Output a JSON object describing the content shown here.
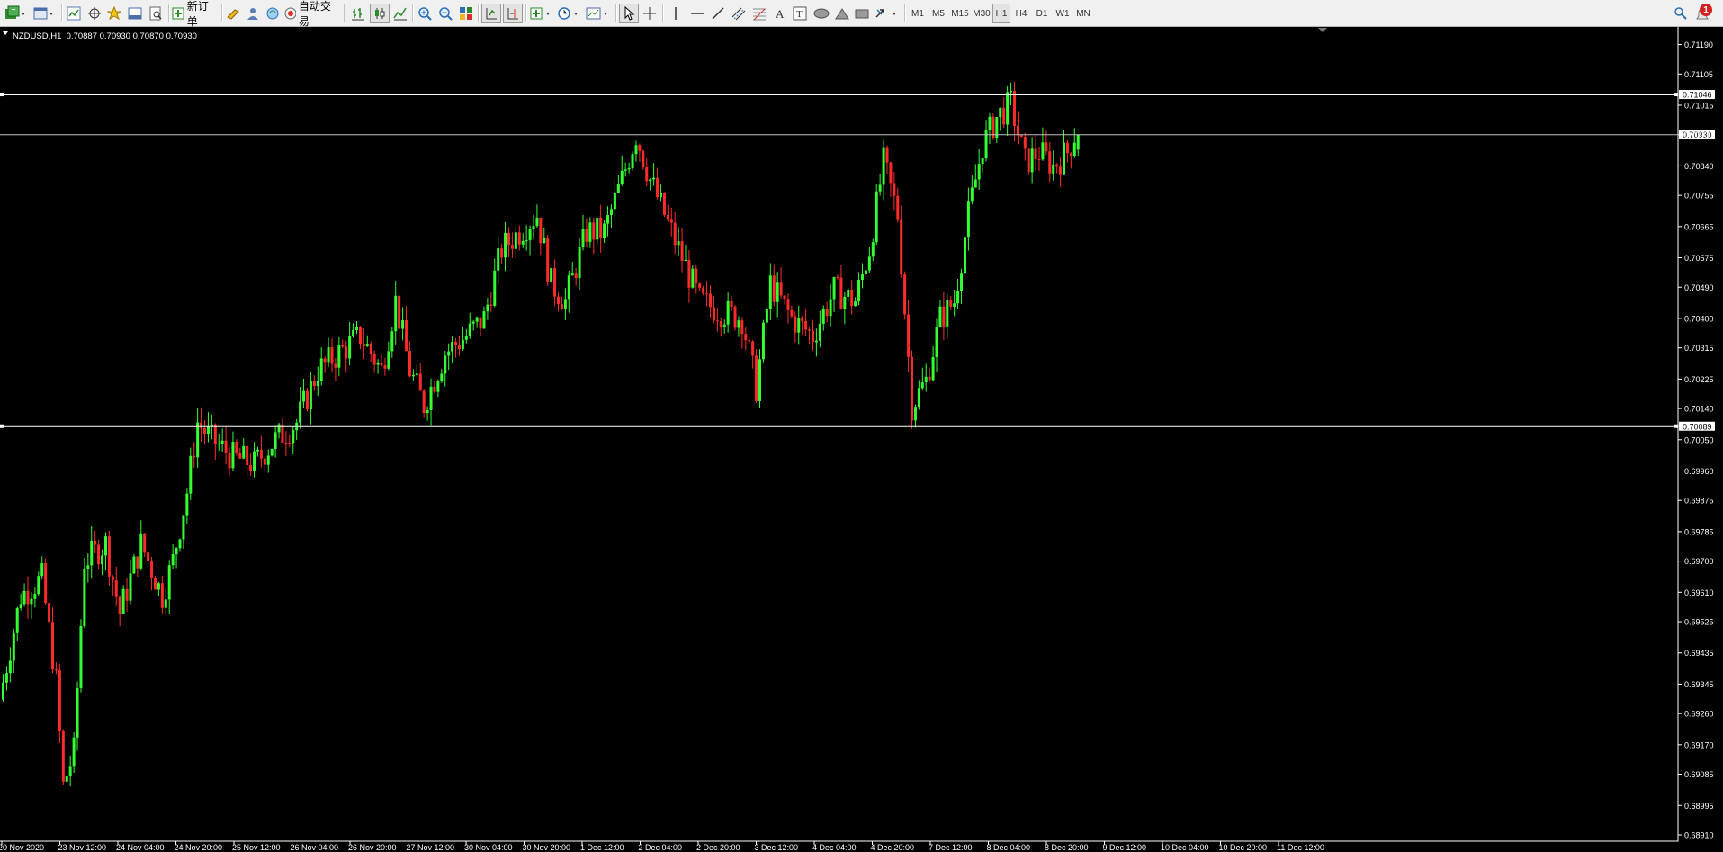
{
  "toolbar": {
    "new_order_label": "新订单",
    "auto_trade_label": "自动交易",
    "timeframes": [
      "M1",
      "M5",
      "M15",
      "M30",
      "H1",
      "H4",
      "D1",
      "W1",
      "MN"
    ],
    "active_timeframe": "H1",
    "notification_count": "1"
  },
  "chart_header": {
    "symbol_info": "NZDUSD,H1  0.70887 0.70930 0.70870 0.70930"
  },
  "colors": {
    "background": "#000000",
    "bull_candle": "#33ff33",
    "bear_candle": "#ff2b2b",
    "axis_text": "#ffffff",
    "hline": "#ffffff",
    "price_line": "#c0c0c0"
  },
  "chart_data": {
    "type": "candlestick",
    "symbol": "NZDUSD",
    "timeframe": "H1",
    "last_bar": {
      "open": 0.70887,
      "high": 0.7093,
      "low": 0.7087,
      "close": 0.7093
    },
    "y_ticks": [
      "0.71190",
      "0.71105",
      "0.71015",
      "0.70930",
      "0.70840",
      "0.70755",
      "0.70665",
      "0.70575",
      "0.70490",
      "0.70400",
      "0.70315",
      "0.70225",
      "0.70140",
      "0.70050",
      "0.69960",
      "0.69875",
      "0.69785",
      "0.69700",
      "0.69610",
      "0.69525",
      "0.69435",
      "0.69345",
      "0.69260",
      "0.69170",
      "0.69085",
      "0.68995",
      "0.68910"
    ],
    "ylim": [
      0.6891,
      0.7122
    ],
    "x_ticks": [
      "20 Nov 2020",
      "23 Nov 12:00",
      "24 Nov 04:00",
      "24 Nov 20:00",
      "25 Nov 12:00",
      "26 Nov 04:00",
      "26 Nov 20:00",
      "27 Nov 12:00",
      "30 Nov 04:00",
      "30 Nov 20:00",
      "1 Dec 12:00",
      "2 Dec 04:00",
      "2 Dec 20:00",
      "3 Dec 12:00",
      "4 Dec 04:00",
      "4 Dec 20:00",
      "7 Dec 12:00",
      "8 Dec 04:00",
      "8 Dec 20:00",
      "9 Dec 12:00",
      "10 Dec 04:00",
      "10 Dec 20:00",
      "11 Dec 12:00"
    ],
    "horizontal_lines": [
      {
        "price": 0.71046,
        "label": "0.71046"
      },
      {
        "price": 0.70089,
        "label": "0.70089"
      }
    ],
    "current_price": {
      "price": 0.7093,
      "label": "0.70930"
    },
    "anchors": [
      [
        0,
        0.693
      ],
      [
        6,
        0.696
      ],
      [
        12,
        0.6965
      ],
      [
        16,
        0.6935
      ],
      [
        18,
        0.6905
      ],
      [
        21,
        0.6915
      ],
      [
        24,
        0.697
      ],
      [
        30,
        0.6975
      ],
      [
        34,
        0.6955
      ],
      [
        40,
        0.6975
      ],
      [
        46,
        0.696
      ],
      [
        49,
        0.697
      ],
      [
        53,
        0.699
      ],
      [
        56,
        0.701
      ],
      [
        60,
        0.7005
      ],
      [
        66,
        0.7
      ],
      [
        72,
        0.6998
      ],
      [
        78,
        0.7005
      ],
      [
        84,
        0.701
      ],
      [
        90,
        0.7025
      ],
      [
        96,
        0.703
      ],
      [
        102,
        0.7035
      ],
      [
        108,
        0.7025
      ],
      [
        112,
        0.7045
      ],
      [
        116,
        0.7025
      ],
      [
        120,
        0.7015
      ],
      [
        126,
        0.703
      ],
      [
        132,
        0.7035
      ],
      [
        137,
        0.704
      ],
      [
        142,
        0.706
      ],
      [
        147,
        0.7065
      ],
      [
        152,
        0.707
      ],
      [
        156,
        0.705
      ],
      [
        160,
        0.7045
      ],
      [
        166,
        0.7065
      ],
      [
        171,
        0.7065
      ],
      [
        176,
        0.708
      ],
      [
        180,
        0.7093
      ],
      [
        184,
        0.708
      ],
      [
        188,
        0.707
      ],
      [
        192,
        0.706
      ],
      [
        198,
        0.7045
      ],
      [
        204,
        0.7042
      ],
      [
        210,
        0.704
      ],
      [
        214,
        0.702
      ],
      [
        218,
        0.705
      ],
      [
        224,
        0.704
      ],
      [
        230,
        0.7035
      ],
      [
        236,
        0.7048
      ],
      [
        242,
        0.7045
      ],
      [
        246,
        0.706
      ],
      [
        250,
        0.7085
      ],
      [
        254,
        0.707
      ],
      [
        258,
        0.7015
      ],
      [
        262,
        0.7022
      ],
      [
        266,
        0.704
      ],
      [
        270,
        0.7045
      ],
      [
        274,
        0.707
      ],
      [
        278,
        0.709
      ],
      [
        282,
        0.7098
      ],
      [
        286,
        0.7102
      ],
      [
        290,
        0.7085
      ],
      [
        294,
        0.7088
      ],
      [
        298,
        0.7084
      ],
      [
        302,
        0.7088
      ],
      [
        304,
        0.7093
      ]
    ]
  }
}
